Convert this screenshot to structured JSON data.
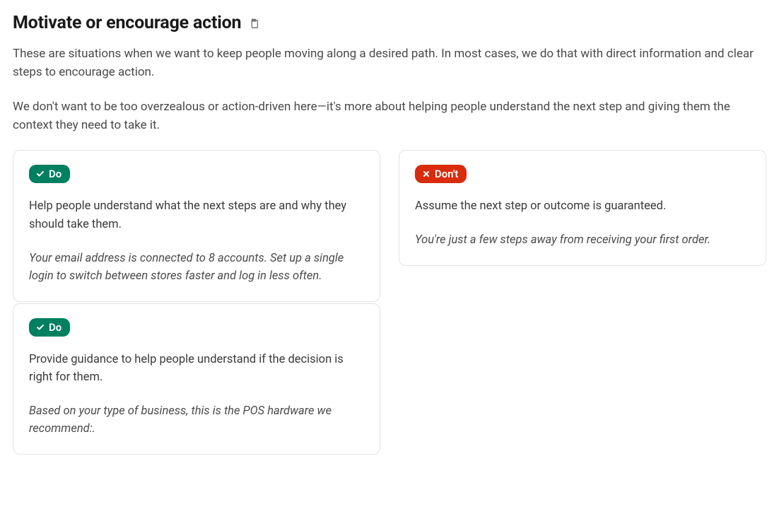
{
  "heading": "Motivate or encourage action",
  "intro_p1": "These are situations when we want to keep people moving along a desired path. In most cases, we do that with direct information and clear steps to encourage action.",
  "intro_p2": "We don't want to be too overzealous or action-driven here—it's more about helping people understand the next step and giving them the context they need to take it.",
  "badge_do": "Do",
  "badge_dont": "Don't",
  "cards": {
    "do1": {
      "desc": "Help people understand what the next steps are and why they should take them.",
      "example": "Your email address is connected to 8 accounts. Set up a single login to switch between stores faster and log in less often."
    },
    "do2": {
      "desc": "Provide guidance to help people understand if the decision is right for them.",
      "example": "Based on your type of business, this is the POS hardware we recommend:."
    },
    "dont1": {
      "desc": "Assume the next step or outcome is guaranteed.",
      "example": "You're just a few steps away from receiving your first order."
    }
  }
}
